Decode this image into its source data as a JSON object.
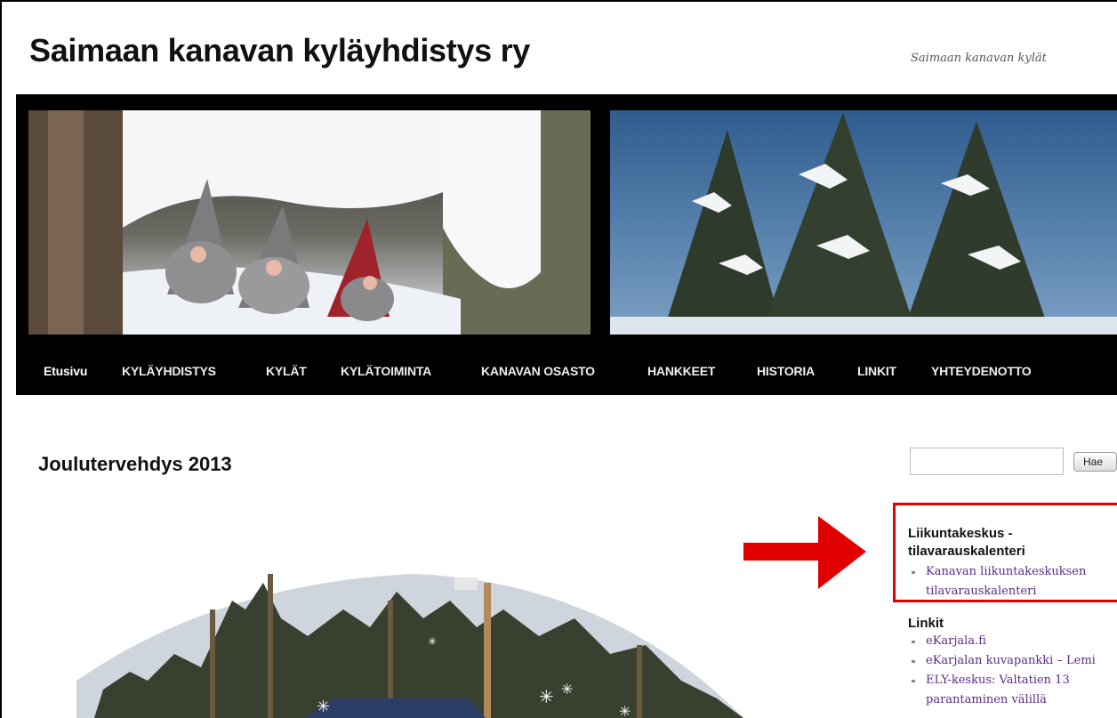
{
  "site": {
    "title": "Saimaan kanavan kyläyhdistys ry",
    "description": "Saimaan kanavan kylät"
  },
  "nav": {
    "items": [
      {
        "label": "Etusivu",
        "current": true
      },
      {
        "label": "KYLÄYHDISTYS"
      },
      {
        "label": "KYLÄT"
      },
      {
        "label": "KYLÄTOIMINTA"
      },
      {
        "label": "KANAVAN OSASTO"
      },
      {
        "label": "HANKKEET"
      },
      {
        "label": "HISTORIA"
      },
      {
        "label": "LINKIT"
      },
      {
        "label": "YHTEYDENOTTO"
      }
    ]
  },
  "post": {
    "title": "Joulutervehdys 2013"
  },
  "search": {
    "placeholder": "",
    "button_label": "Hae"
  },
  "sidebar": {
    "widget1": {
      "title_line1": "Liikuntakeskus -",
      "title_line2": "tilavarauskalenteri",
      "links": [
        "Kanavan liikuntakeskuksen",
        "tilavarauskalenteri"
      ]
    },
    "widget2": {
      "title": "Linkit",
      "links": [
        "eKarjala.fi",
        "eKarjalan kuvapankki – Lemi",
        "ELY-keskus: Valtatien 13",
        "parantaminen välillä"
      ]
    }
  },
  "colors": {
    "highlight_box": "#e00000",
    "arrow": "#e00000",
    "link": "#5a2a8c",
    "nav_bg": "#000000"
  },
  "icons": {
    "arrow": "right-arrow-icon"
  }
}
